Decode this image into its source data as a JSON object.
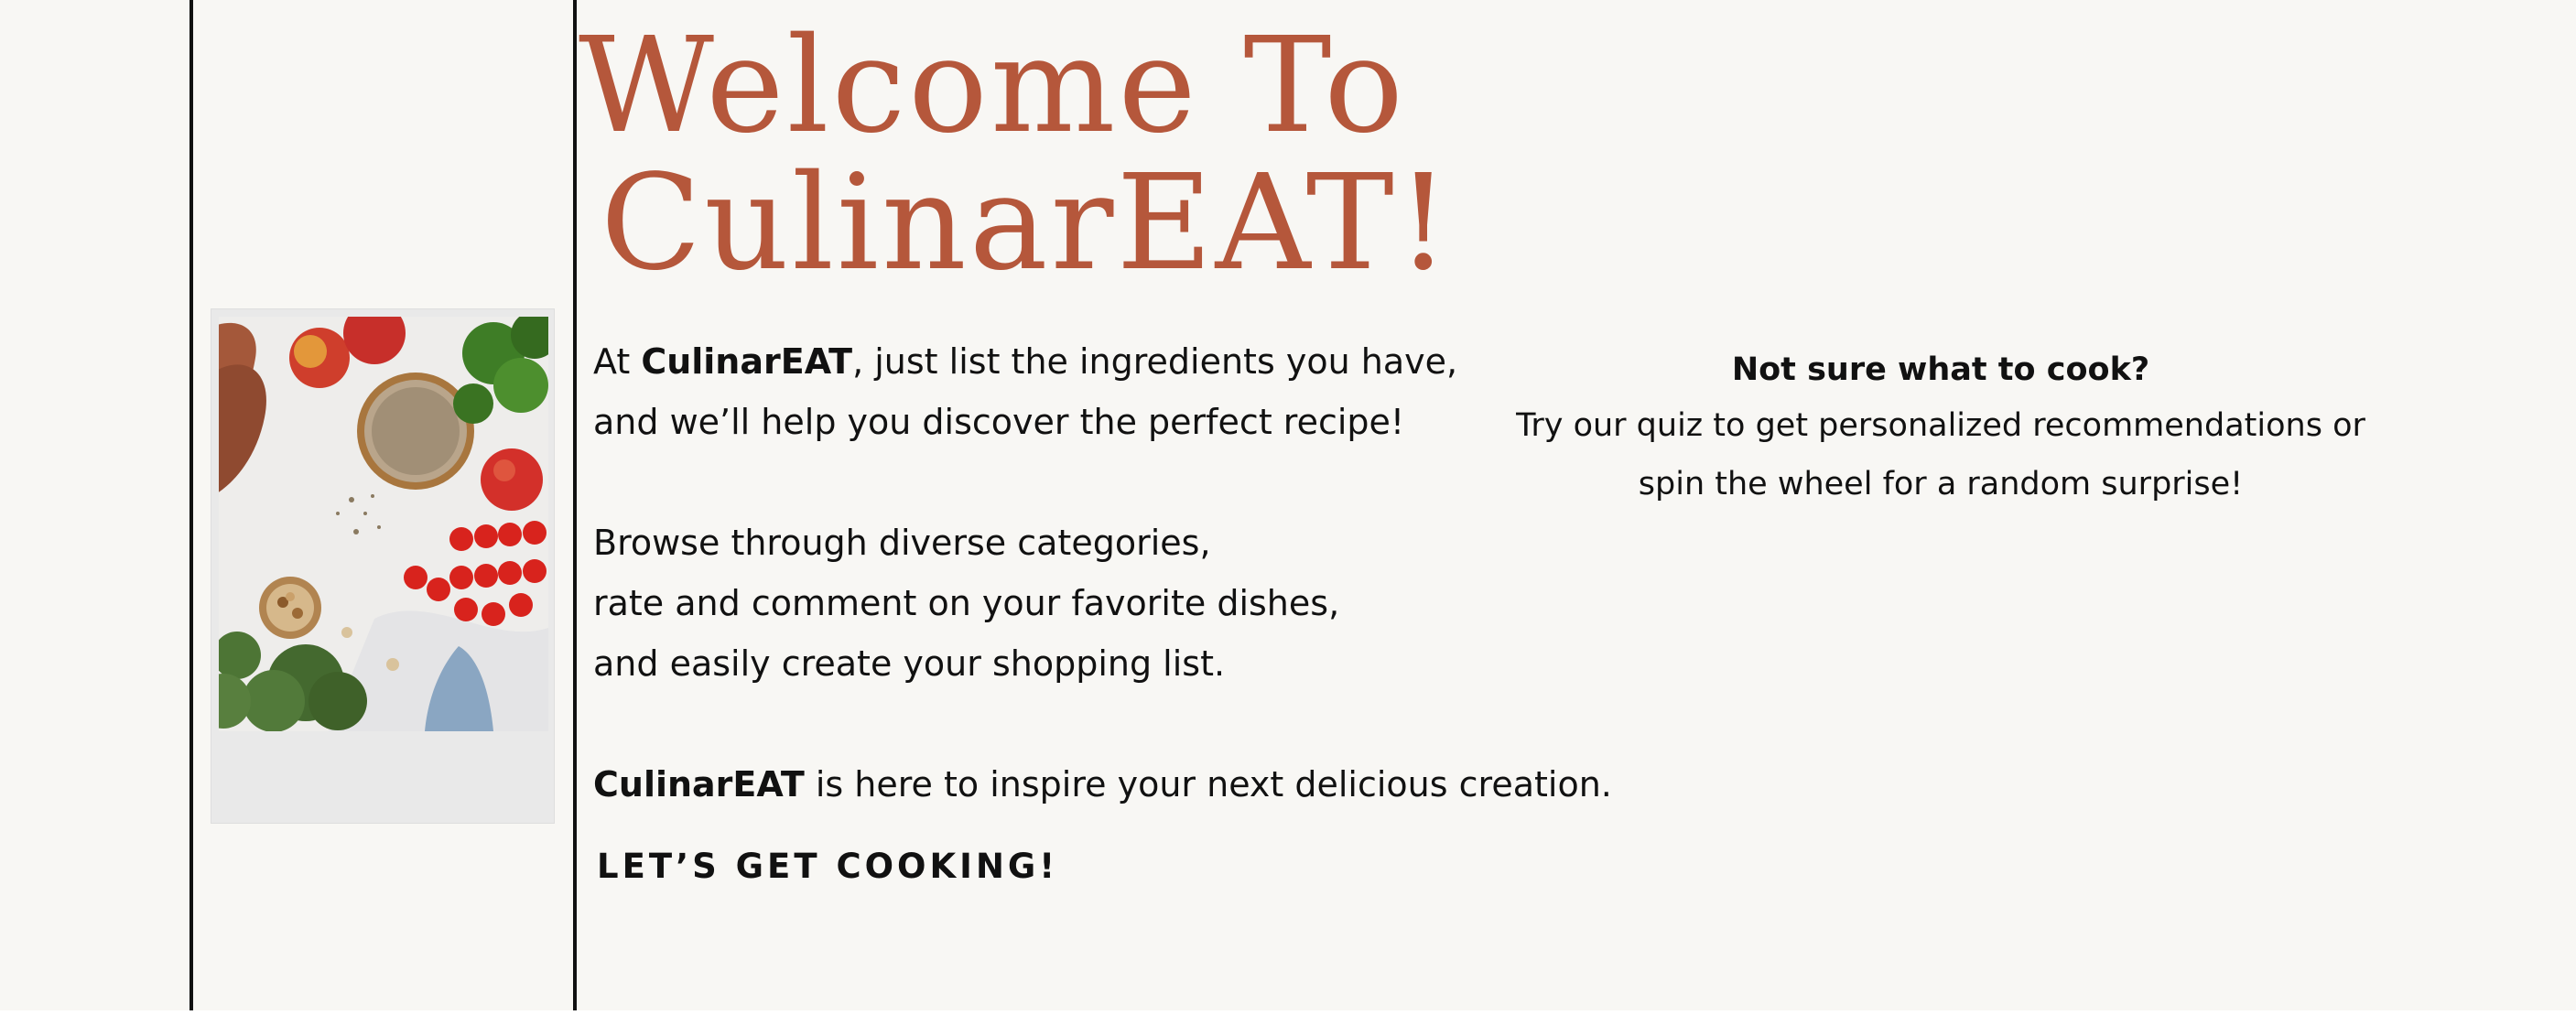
{
  "hero": {
    "title_line1": "Welcome To",
    "title_line2": "CulinarEAT!"
  },
  "intro": {
    "p1_l1_pre": "At ",
    "brand": "CulinarEAT",
    "p1_l1_post": ", just list the ingredients you have,",
    "p1_l2": "and we’ll help you discover the perfect recipe!",
    "p2_l1": "Browse through diverse categories,",
    "p2_l2": "rate and comment on your favorite dishes,",
    "p2_l3": "and easily create your shopping list.",
    "p3_post": " is here to inspire your next delicious creation."
  },
  "cta": {
    "label": "LET’S GET COOKING!"
  },
  "quiz": {
    "heading": "Not sure what to cook?",
    "body_l1": "Try our quiz to get personalized recommendations or",
    "body_l2": "spin the wheel for a random surprise!"
  },
  "colors": {
    "background": "#f8f7f4",
    "accent": "#b5573b",
    "text": "#111111"
  }
}
